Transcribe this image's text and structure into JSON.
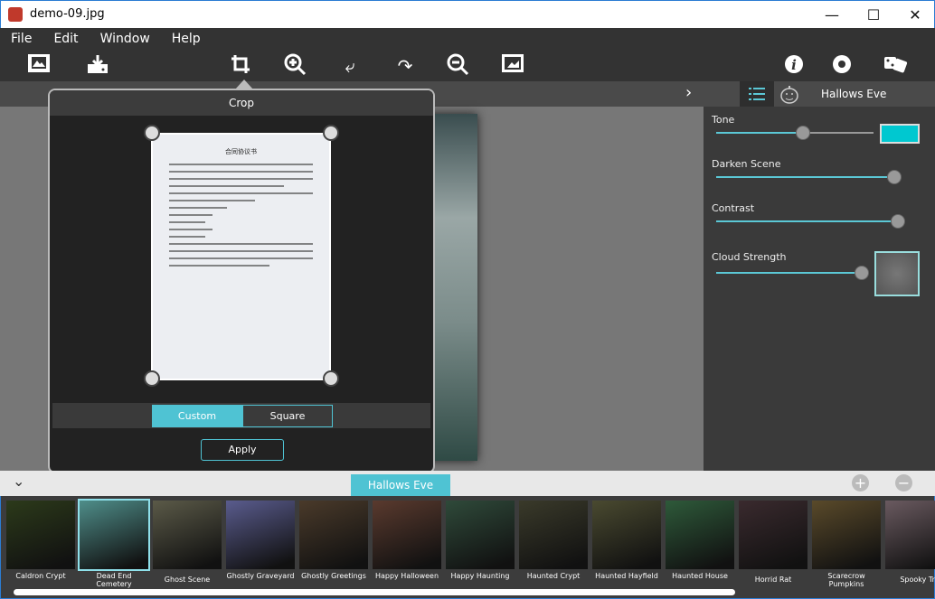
{
  "window": {
    "title": "demo-09.jpg",
    "minimize": "—",
    "maximize": "☐",
    "close": "✕"
  },
  "menu": [
    "File",
    "Edit",
    "Window",
    "Help"
  ],
  "toolbar": {
    "icons": [
      "open-image-icon",
      "save-icon",
      "crop-icon",
      "zoom-in-icon",
      "undo-icon",
      "redo-icon",
      "zoom-out-icon",
      "fit-image-icon",
      "info-icon",
      "settings-icon",
      "random-dice-icon"
    ]
  },
  "subbar": {
    "chevron": "›"
  },
  "right_panel": {
    "preset": "Hallows Eve",
    "tone_label": "Tone",
    "tone_color": "#00c8d0",
    "tone_value": 0.5,
    "darken_label": "Darken Scene",
    "darken_value": 0.92,
    "contrast_label": "Contrast",
    "contrast_value": 0.94,
    "cloud_label": "Cloud Strength",
    "cloud_value": 1.0
  },
  "crop": {
    "title": "Crop",
    "custom": "Custom",
    "square": "Square",
    "apply": "Apply",
    "doc_title": "合同协议书"
  },
  "strip": {
    "collapse": "⌄",
    "active": "Hallows Eve",
    "add": "+",
    "remove": "−"
  },
  "accent": "#4fc3d3",
  "thumbnails": [
    {
      "label": "Caldron Crypt",
      "color": "#2c3a1a"
    },
    {
      "label": "Dead End Cemetery",
      "color": "#4f8e8a",
      "selected": true
    },
    {
      "label": "Ghost Scene",
      "color": "#5b5a48"
    },
    {
      "label": "Ghostly Graveyard",
      "color": "#5a5c8e"
    },
    {
      "label": "Ghostly Greetings",
      "color": "#4a3a2a"
    },
    {
      "label": "Happy Halloween",
      "color": "#5a3a2e"
    },
    {
      "label": "Happy Haunting",
      "color": "#2f4a3a"
    },
    {
      "label": "Haunted Crypt",
      "color": "#3a3a2a"
    },
    {
      "label": "Haunted Hayfield",
      "color": "#4a4a30"
    },
    {
      "label": "Haunted House",
      "color": "#2e5a3a"
    },
    {
      "label": "Horrid Rat",
      "color": "#3a2a2e"
    },
    {
      "label": "Scarecrow Pumpkins",
      "color": "#5a4a2a"
    },
    {
      "label": "Spooky Tre",
      "color": "#6a5a60"
    }
  ]
}
